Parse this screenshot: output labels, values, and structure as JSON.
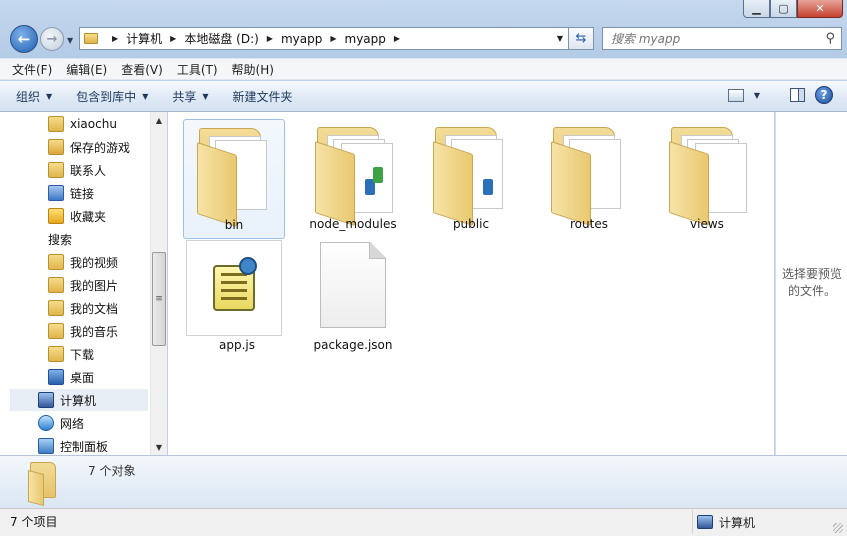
{
  "window": {
    "caption_buttons": [
      "minimize-icon",
      "maximize-icon",
      "close-icon"
    ]
  },
  "address_bar": {
    "crumbs": [
      "计算机",
      "本地磁盘 (D:)",
      "myapp",
      "myapp"
    ]
  },
  "search": {
    "placeholder": "搜索 myapp"
  },
  "menu": [
    "文件(F)",
    "编辑(E)",
    "查看(V)",
    "工具(T)",
    "帮助(H)"
  ],
  "toolbar": {
    "organize": "组织",
    "include_library": "包含到库中",
    "share": "共享",
    "new_folder": "新建文件夹"
  },
  "nav_pane": {
    "items": [
      {
        "label": "xiaochu",
        "icon": "user-folder-icon"
      },
      {
        "label": "保存的游戏",
        "icon": "saved-games-icon"
      },
      {
        "label": "联系人",
        "icon": "contacts-icon"
      },
      {
        "label": "链接",
        "icon": "links-icon"
      },
      {
        "label": "收藏夹",
        "icon": "favorites-icon"
      },
      {
        "label": "搜索",
        "icon": "searches-icon"
      },
      {
        "label": "我的视频",
        "icon": "videos-icon"
      },
      {
        "label": "我的图片",
        "icon": "pictures-icon"
      },
      {
        "label": "我的文档",
        "icon": "documents-icon"
      },
      {
        "label": "我的音乐",
        "icon": "music-icon"
      },
      {
        "label": "下载",
        "icon": "downloads-icon"
      },
      {
        "label": "桌面",
        "icon": "desktop-icon"
      },
      {
        "label": "计算机",
        "icon": "computer-icon"
      },
      {
        "label": "网络",
        "icon": "network-icon"
      },
      {
        "label": "控制面板",
        "icon": "control-panel-icon"
      }
    ]
  },
  "files": [
    {
      "name": "bin",
      "type": "folder"
    },
    {
      "name": "node_modules",
      "type": "folder"
    },
    {
      "name": "public",
      "type": "folder"
    },
    {
      "name": "routes",
      "type": "folder"
    },
    {
      "name": "views",
      "type": "folder"
    },
    {
      "name": "app.js",
      "type": "script"
    },
    {
      "name": "package.json",
      "type": "file"
    }
  ],
  "preview_pane": {
    "message_line1": "选择要预览",
    "message_line2": "的文件。"
  },
  "details_pane": {
    "text": "7 个对象"
  },
  "status_bar": {
    "item_count": "7 个项目",
    "location": "计算机"
  }
}
